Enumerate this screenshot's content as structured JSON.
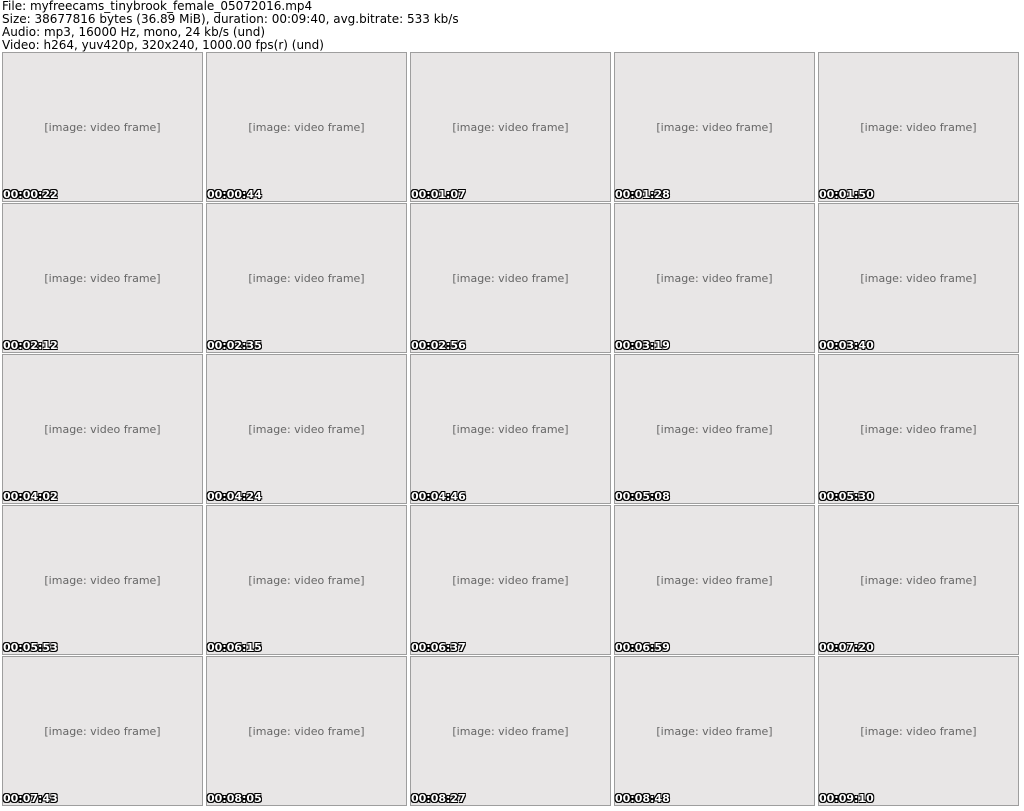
{
  "header": {
    "file_line": "File: myfreecams_tinybrook_female_05072016.mp4",
    "size_line": "Size: 38677816 bytes (36.89 MiB), duration: 00:09:40, avg.bitrate: 533 kb/s",
    "audio_line": "Audio: mp3, 16000 Hz, mono, 24 kb/s (und)",
    "video_line": "Video: h264, yuv420p, 320x240, 1000.00 fps(r) (und)"
  },
  "thumbnails": [
    {
      "timestamp": "00:00:22"
    },
    {
      "timestamp": "00:00:44"
    },
    {
      "timestamp": "00:01:07"
    },
    {
      "timestamp": "00:01:28"
    },
    {
      "timestamp": "00:01:50"
    },
    {
      "timestamp": "00:02:12"
    },
    {
      "timestamp": "00:02:35"
    },
    {
      "timestamp": "00:02:56"
    },
    {
      "timestamp": "00:03:19"
    },
    {
      "timestamp": "00:03:40"
    },
    {
      "timestamp": "00:04:02"
    },
    {
      "timestamp": "00:04:24"
    },
    {
      "timestamp": "00:04:46"
    },
    {
      "timestamp": "00:05:08"
    },
    {
      "timestamp": "00:05:30"
    },
    {
      "timestamp": "00:05:53"
    },
    {
      "timestamp": "00:06:15"
    },
    {
      "timestamp": "00:06:37"
    },
    {
      "timestamp": "00:06:59"
    },
    {
      "timestamp": "00:07:20"
    },
    {
      "timestamp": "00:07:43"
    },
    {
      "timestamp": "00:08:05"
    },
    {
      "timestamp": "00:08:27"
    },
    {
      "timestamp": "00:08:48"
    },
    {
      "timestamp": "00:09:10"
    }
  ]
}
